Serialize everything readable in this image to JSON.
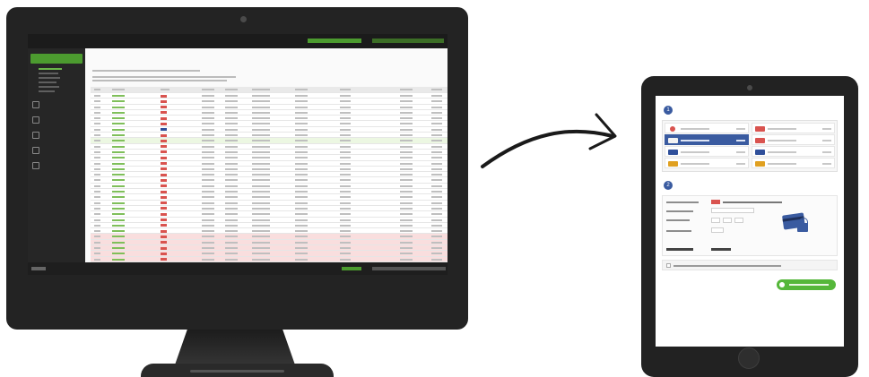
{
  "desktop": {
    "topbar": {
      "right_links": [
        "",
        ""
      ]
    },
    "sidebar": {
      "active_section": "",
      "items": [
        "",
        "",
        "",
        "",
        ""
      ]
    },
    "main": {
      "title": "",
      "table_rows": 30
    },
    "footer": {
      "support": ""
    }
  },
  "tablet": {
    "step1": {
      "number": "1",
      "title": ""
    },
    "step2": {
      "number": "2",
      "title": ""
    },
    "checkout_button": ""
  },
  "colors": {
    "accent_green": "#4c9b2f",
    "brand_blue": "#3a5ba0",
    "device_dark": "#232323",
    "row_highlight_green": "#ecf7e2",
    "row_highlight_red": "#f9dede"
  },
  "icons": {
    "arrow": "curved-arrow-icon",
    "monitor": "monitor-device-icon",
    "tablet": "tablet-device-icon"
  }
}
